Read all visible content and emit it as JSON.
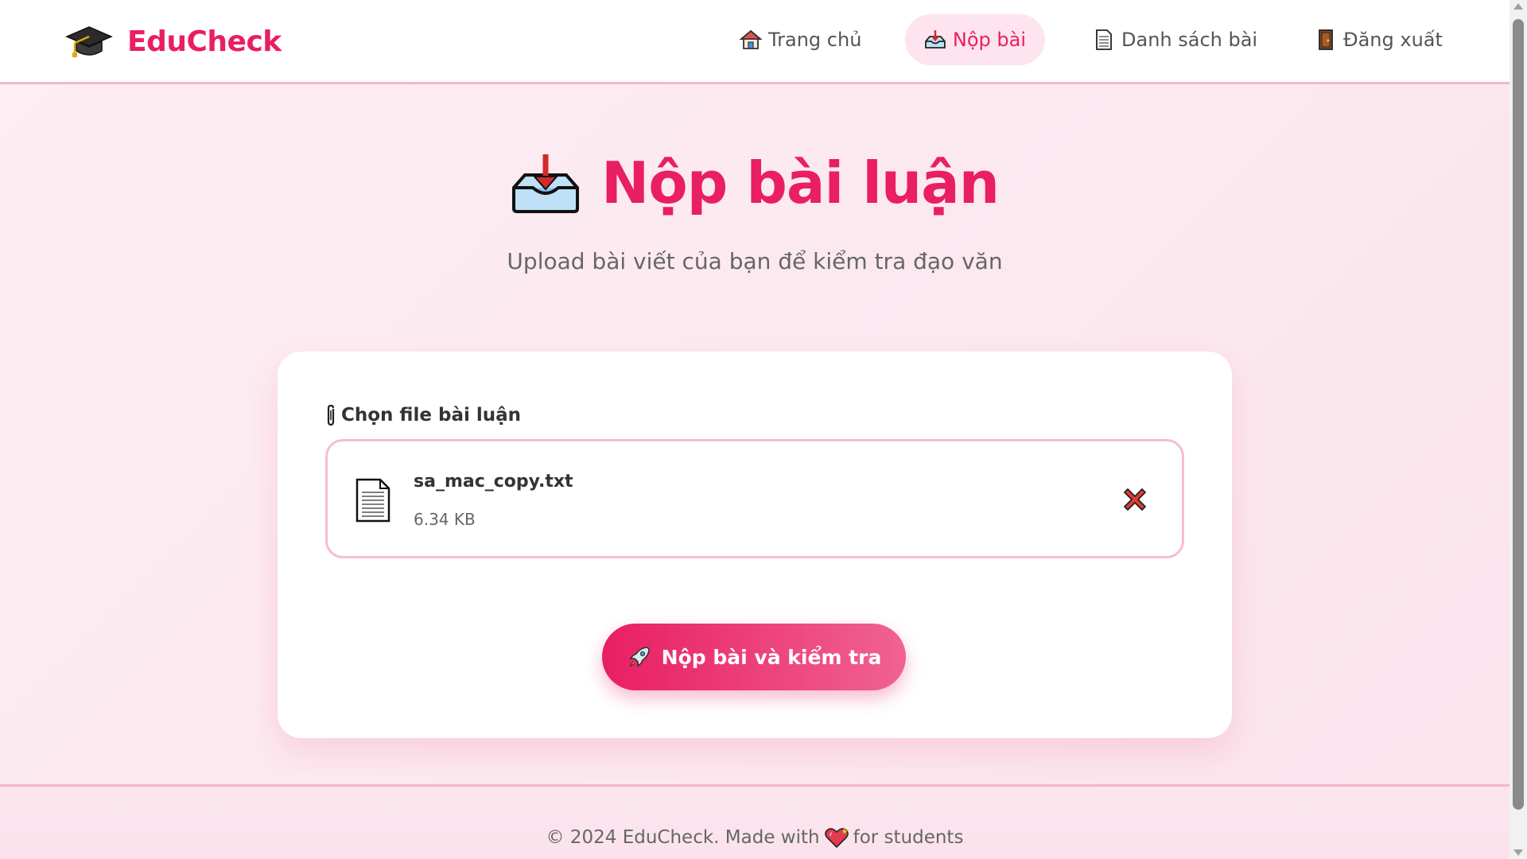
{
  "brand": {
    "name": "EduCheck",
    "icon": "graduation-cap-icon"
  },
  "nav": {
    "items": [
      {
        "label": "Trang chủ",
        "icon": "house-icon",
        "active": false
      },
      {
        "label": "Nộp bài",
        "icon": "inbox-tray-icon",
        "active": true
      },
      {
        "label": "Danh sách bài",
        "icon": "page-icon",
        "active": false
      },
      {
        "label": "Đăng xuất",
        "icon": "door-icon",
        "active": false
      }
    ]
  },
  "main": {
    "title": "Nộp bài luận",
    "title_icon": "inbox-tray-icon",
    "subtitle": "Upload bài viết của bạn để kiểm tra đạo văn"
  },
  "upload": {
    "label": "Chọn file bài luận",
    "label_icon": "paperclip-icon",
    "file": {
      "name": "sa_mac_copy.txt",
      "size": "6.34 KB",
      "icon": "document-icon"
    },
    "remove_icon": "cross-mark-icon",
    "submit_label": "Nộp bài và kiểm tra",
    "submit_icon": "rocket-icon"
  },
  "footer": {
    "text_before": "© 2024 EduCheck. Made with",
    "text_after": "for students",
    "icon": "heart-icon"
  },
  "colors": {
    "accent": "#e91e63",
    "accent_light": "#f06292",
    "nav_active_bg": "#fde4ee",
    "border_pink": "#f8bcd3",
    "page_bg": "#fdeef3"
  }
}
